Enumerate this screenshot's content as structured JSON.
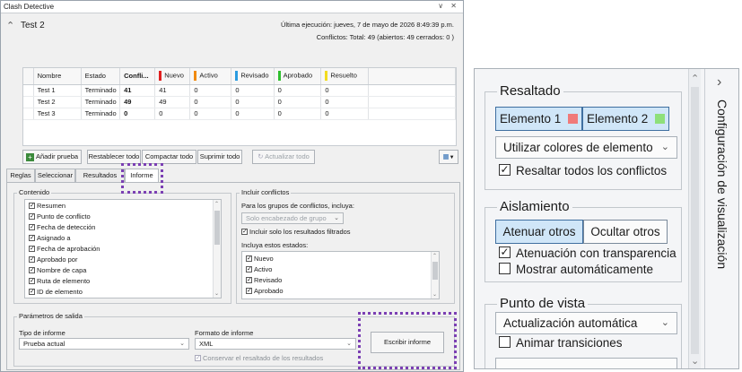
{
  "window": {
    "title": "Clash Detective",
    "controls": "∨ ✕"
  },
  "test": {
    "name": "Test 2",
    "last_run": "Última ejecución:  jueves, 7 de mayo de 2026 8:49:39 p.m.",
    "conflicts_summary": "Conflictos:  Total:  49  (abiertos:  49  cerrados:  0 )"
  },
  "grid": {
    "columns": [
      {
        "label": "Nombre",
        "swatch": ""
      },
      {
        "label": "Estado",
        "swatch": ""
      },
      {
        "label": "Confli...",
        "swatch": "",
        "bold": true
      },
      {
        "label": "Nuevo",
        "swatch": "#e02020"
      },
      {
        "label": "Activo",
        "swatch": "#f08a10"
      },
      {
        "label": "Revisado",
        "swatch": "#2a9be0"
      },
      {
        "label": "Aprobado",
        "swatch": "#2fbf2f"
      },
      {
        "label": "Resuelto",
        "swatch": "#f2dc20"
      }
    ],
    "rows": [
      [
        "Test 1",
        "Terminado",
        "41",
        "41",
        "0",
        "0",
        "0",
        "0"
      ],
      [
        "Test 2",
        "Terminado",
        "49",
        "49",
        "0",
        "0",
        "0",
        "0"
      ],
      [
        "Test 3",
        "Terminado",
        "0",
        "0",
        "0",
        "0",
        "0",
        "0"
      ]
    ]
  },
  "toolbar": {
    "add_test": "Añadir prueba",
    "reset_all": "Restablecer todo",
    "compact_all": "Compactar todo",
    "delete_all": "Suprimir todo",
    "update_all": "Actualizar todo"
  },
  "tabs": [
    "Reglas",
    "Seleccionar",
    "Resultados",
    "Informe"
  ],
  "contents": {
    "title": "Contenido",
    "items": [
      "Resumen",
      "Punto de conflicto",
      "Fecha de detección",
      "Asignado a",
      "Fecha de aprobación",
      "Aprobado por",
      "Nombre de capa",
      "Ruta de elemento",
      "ID de elemento"
    ]
  },
  "include": {
    "title": "Incluir conflictos",
    "groups_label": "Para los grupos de conflictos, incluya:",
    "groups_value": "Solo encabezado de grupo",
    "filtered_label": "Incluir solo los resultados filtrados",
    "states_label": "Incluya estos estados:",
    "states": [
      "Nuevo",
      "Activo",
      "Revisado",
      "Aprobado"
    ]
  },
  "output": {
    "title": "Parámetros de salida",
    "report_type_label": "Tipo de informe",
    "report_type_value": "Prueba actual",
    "report_format_label": "Formato de informe",
    "report_format_value": "XML",
    "keep_highlight": "Conservar el resaltado de los resultados",
    "write_button": "Escribir informe"
  },
  "viz": {
    "side_title": "Configuración de visualización",
    "highlight": {
      "title": "Resaltado",
      "item1": "Elemento 1",
      "item2": "Elemento 2",
      "item1_color": "#f07a7a",
      "item2_color": "#8ee07a",
      "mode": "Utilizar colores de elemento",
      "highlight_all": "Resaltar todos los conflictos"
    },
    "isolation": {
      "title": "Aislamiento",
      "dim": "Atenuar otros",
      "hide": "Ocultar otros",
      "transparency": "Atenuación con transparencia",
      "auto_show": "Mostrar automáticamente"
    },
    "viewpoint": {
      "title": "Punto de vista",
      "mode": "Actualización automática",
      "animate": "Animar transiciones"
    }
  }
}
